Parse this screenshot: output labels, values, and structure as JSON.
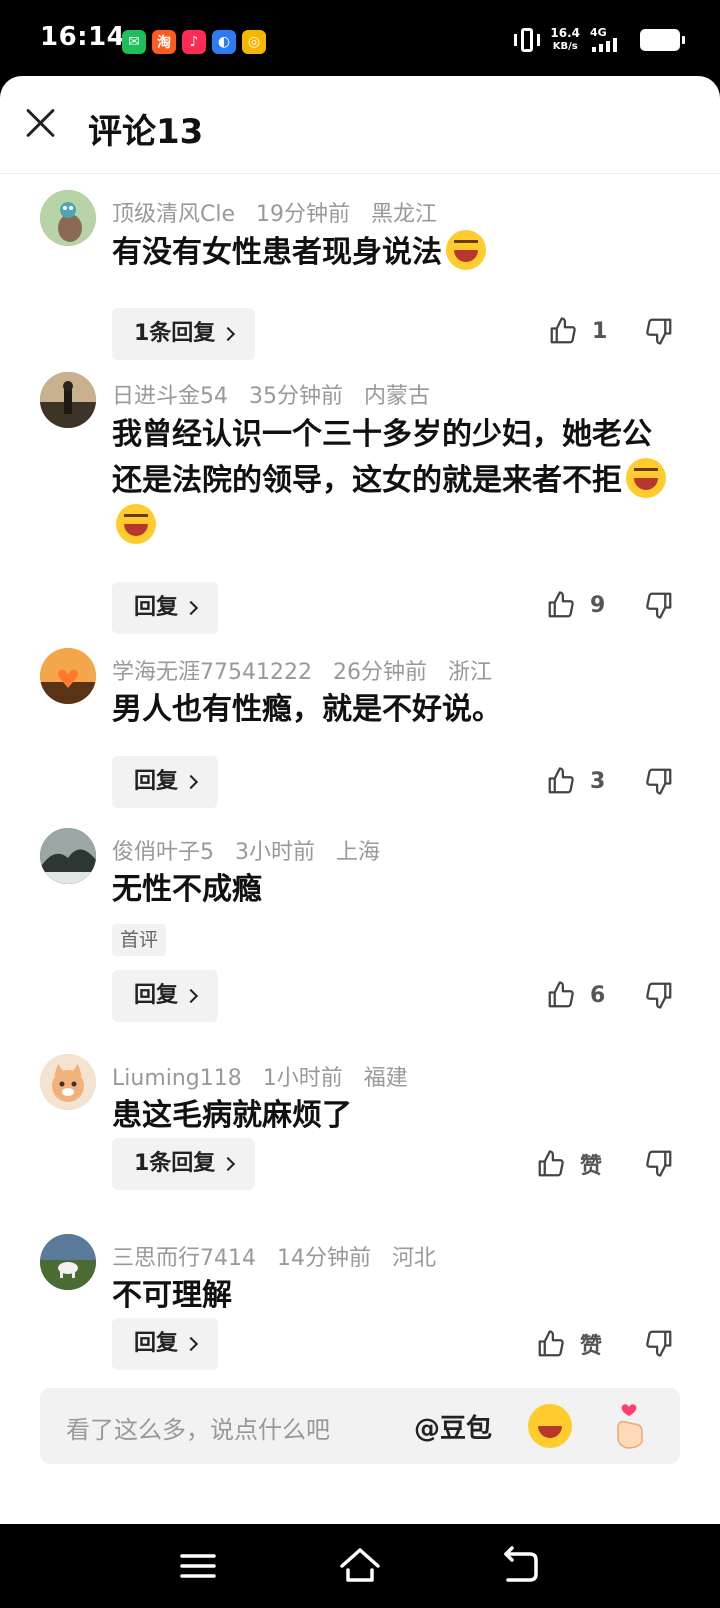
{
  "status_bar": {
    "time": "16:14",
    "apps": [
      {
        "icon": "wechat-icon",
        "color": "#1fbe5a",
        "glyph": "✉"
      },
      {
        "icon": "taobao-icon",
        "color": "#ff5a1f",
        "glyph": "淘"
      },
      {
        "icon": "douyin-icon",
        "color": "#fe2c55",
        "glyph": "♪"
      },
      {
        "icon": "browser-icon",
        "color": "#2d7cf6",
        "glyph": "◐"
      },
      {
        "icon": "wallet-icon",
        "color": "#f6b700",
        "glyph": "◎"
      }
    ],
    "net_speed": "16.4",
    "net_unit": "KB/s",
    "network": "4G",
    "battery_level": 0.85
  },
  "header": {
    "title": "评论13"
  },
  "comments": [
    {
      "user": "顶级清风Cle",
      "time": "19分钟前",
      "location": "黑龙江",
      "text": "有没有女性患者现身说法",
      "emoji_count": 1,
      "reply_label": "1条回复",
      "likes": "1",
      "avatar_color": "#9cbf8a"
    },
    {
      "user": "日进斗金54",
      "time": "35分钟前",
      "location": "内蒙古",
      "text": "我曾经认识一个三十多岁的少妇，她老公还是法院的领导，这女的就是来者不拒",
      "emoji_count": 2,
      "reply_label": "回复",
      "likes": "9",
      "avatar_color": "#5a4a3a"
    },
    {
      "user": "学海无涯77541222",
      "time": "26分钟前",
      "location": "浙江",
      "text": "男人也有性瘾，就是不好说。",
      "reply_label": "回复",
      "likes": "3",
      "avatar_color": "#e59a3a"
    },
    {
      "user": "俊俏叶子5",
      "time": "3小时前",
      "location": "上海",
      "text": "无性不成瘾",
      "tag": "首评",
      "reply_label": "回复",
      "likes": "6",
      "avatar_color": "#3d4a45"
    },
    {
      "user": "Liuming118",
      "time": "1小时前",
      "location": "福建",
      "text": "患这毛病就麻烦了",
      "reply_label": "1条回复",
      "likes": "赞",
      "avatar_color": "#e8c39a"
    },
    {
      "user": "三思而行7414",
      "time": "14分钟前",
      "location": "河北",
      "text": "不可理解",
      "reply_label": "回复",
      "likes": "赞",
      "avatar_color": "#5f7a4a"
    }
  ],
  "input_bar": {
    "placeholder": "看了这么多，说点什么吧",
    "mention": "@豆包"
  }
}
